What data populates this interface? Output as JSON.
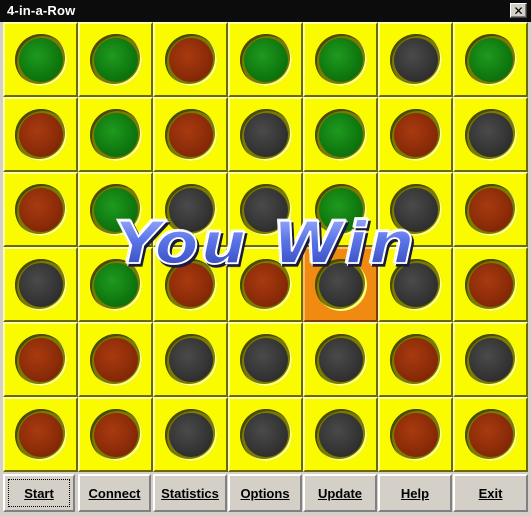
{
  "window": {
    "title": "4-in-a-Row",
    "close_glyph": "✕"
  },
  "game": {
    "status_text": "You Win",
    "rows": 6,
    "cols": 7,
    "board": [
      [
        "green",
        "green",
        "red",
        "green",
        "green",
        "black",
        "green"
      ],
      [
        "red",
        "green",
        "red",
        "black",
        "green",
        "red",
        "black"
      ],
      [
        "red",
        "green",
        "black",
        "black",
        "green",
        "black",
        "red"
      ],
      [
        "black",
        "green",
        "red",
        "red",
        "black",
        "black",
        "red"
      ],
      [
        "red",
        "red",
        "black",
        "black",
        "black",
        "red",
        "black"
      ],
      [
        "red",
        "red",
        "black",
        "black",
        "black",
        "red",
        "red"
      ]
    ],
    "highlighted_cell": {
      "row": 3,
      "col": 4
    },
    "colors": {
      "board_yellow": "#fbfb00",
      "highlight_orange": "#f08a10",
      "green": "#0f7a0f",
      "red": "#8c2c08",
      "black": "#353535"
    }
  },
  "buttons": [
    {
      "id": "start",
      "label": "Start"
    },
    {
      "id": "connect",
      "label": "Connect"
    },
    {
      "id": "statistics",
      "label": "Statistics"
    },
    {
      "id": "options",
      "label": "Options"
    },
    {
      "id": "update",
      "label": "Update"
    },
    {
      "id": "help",
      "label": "Help"
    },
    {
      "id": "exit",
      "label": "Exit"
    }
  ]
}
